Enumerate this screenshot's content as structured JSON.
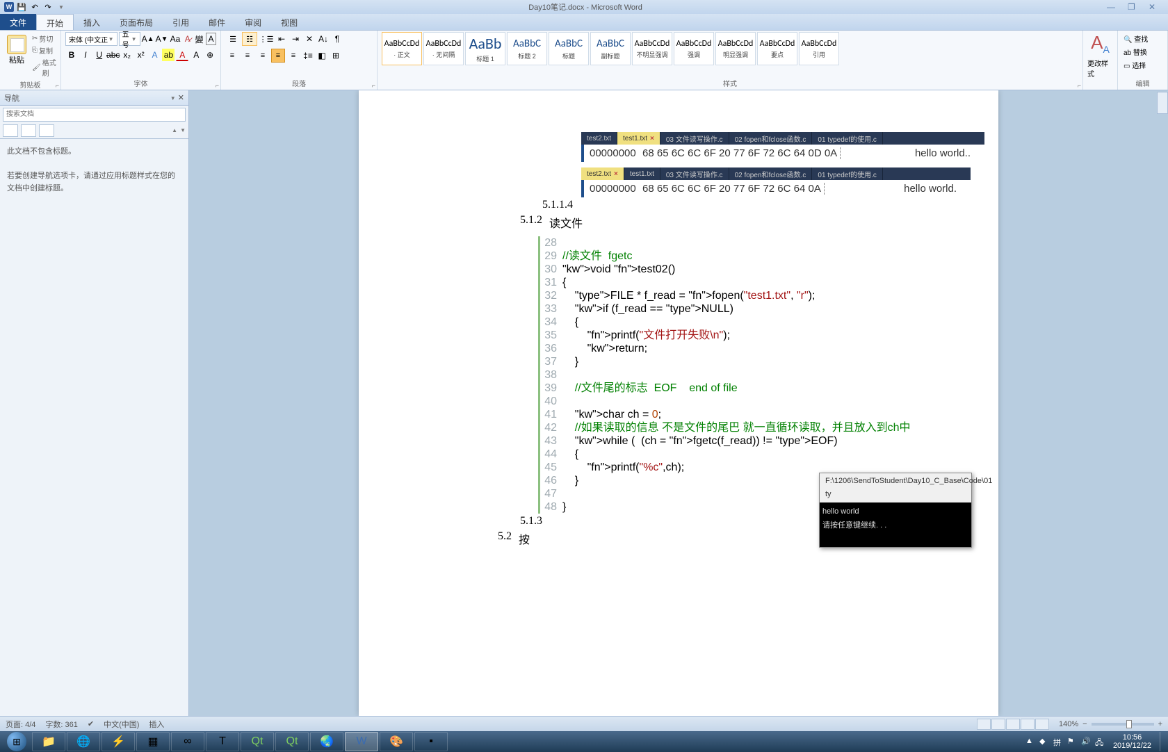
{
  "window": {
    "title": "Day10笔记.docx - Microsoft Word"
  },
  "ribbon": {
    "tabs": {
      "file": "文件",
      "home": "开始",
      "insert": "插入",
      "pagelayout": "页面布局",
      "references": "引用",
      "mailings": "邮件",
      "review": "审阅",
      "view": "视图"
    },
    "clipboard": {
      "paste": "粘贴",
      "cut": "剪切",
      "copy": "复制",
      "format_painter": "格式刷",
      "title": "剪贴板"
    },
    "font": {
      "name": "宋体 (中文正",
      "size": "五号",
      "title": "字体"
    },
    "paragraph": {
      "title": "段落"
    },
    "styles": {
      "title": "样式",
      "items": [
        {
          "preview": "AaBbCcDd",
          "name": "· 正文",
          "cls": ""
        },
        {
          "preview": "AaBbCcDd",
          "name": "· 无间隔",
          "cls": ""
        },
        {
          "preview": "AaBb",
          "name": "标题 1",
          "cls": "big"
        },
        {
          "preview": "AaBbC",
          "name": "标题 2",
          "cls": "med"
        },
        {
          "preview": "AaBbC",
          "name": "标题",
          "cls": "med"
        },
        {
          "preview": "AaBbC",
          "name": "副标题",
          "cls": "med"
        },
        {
          "preview": "AaBbCcDd",
          "name": "不明显强调",
          "cls": ""
        },
        {
          "preview": "AaBbCcDd",
          "name": "强调",
          "cls": ""
        },
        {
          "preview": "AaBbCcDd",
          "name": "明显强调",
          "cls": ""
        },
        {
          "preview": "AaBbCcDd",
          "name": "要点",
          "cls": ""
        },
        {
          "preview": "AaBbCcDd",
          "name": "引用",
          "cls": ""
        }
      ],
      "change": "更改样式"
    },
    "editing": {
      "find": "查找",
      "replace": "替换",
      "select": "选择",
      "title": "编辑"
    }
  },
  "nav": {
    "title": "导航",
    "search_placeholder": "搜索文档",
    "msg1": "此文档不包含标题。",
    "msg2": "若要创建导航选项卡，请通过应用标题样式在您的文档中创建标题。"
  },
  "doc": {
    "hex1": {
      "tabs": [
        "test2.txt",
        "test1.txt",
        "03 文件读写操作.c",
        "02 fopen和fclose函数.c",
        "01 typedef的使用.c"
      ],
      "active": 1,
      "offset": "00000000",
      "bytes": "68 65 6C 6C 6F 20 77 6F  72 6C 64 0D 0A",
      "ascii": "hello world.."
    },
    "hex2": {
      "tabs": [
        "test2.txt",
        "test1.txt",
        "03 文件读写操作.c",
        "02 fopen和fclose函数.c",
        "01 typedef的使用.c"
      ],
      "active": 0,
      "offset": "00000000",
      "bytes": "68 65 6C 6C 6F 20 77 6F  72 6C 64 0A",
      "ascii": "hello world."
    },
    "sec_5114": "5.1.1.4",
    "sec_512": "5.1.2",
    "sec_512_title": "读文件",
    "sec_513": "5.1.3",
    "sec_52": "5.2",
    "sec_52_title": "按",
    "code": [
      {
        "n": "28",
        "t": ""
      },
      {
        "n": "29",
        "t": "//读文件  fgetc",
        "cls": "cmt"
      },
      {
        "n": "30",
        "t": "void test02()"
      },
      {
        "n": "31",
        "t": "{"
      },
      {
        "n": "32",
        "t": "    FILE * f_read = fopen(\"test1.txt\", \"r\");"
      },
      {
        "n": "33",
        "t": "    if (f_read == NULL)"
      },
      {
        "n": "34",
        "t": "    {"
      },
      {
        "n": "35",
        "t": "        printf(\"文件打开失败\\n\");"
      },
      {
        "n": "36",
        "t": "        return;"
      },
      {
        "n": "37",
        "t": "    }"
      },
      {
        "n": "38",
        "t": ""
      },
      {
        "n": "39",
        "t": "    //文件尾的标志  EOF    end of file",
        "cls": "cmt"
      },
      {
        "n": "40",
        "t": ""
      },
      {
        "n": "41",
        "t": "    char ch = 0;"
      },
      {
        "n": "42",
        "t": "    //如果读取的信息 不是文件的尾巴 就一直循环读取，并且放入到ch中",
        "cls": "cmt"
      },
      {
        "n": "43",
        "t": "    while (  (ch = fgetc(f_read)) != EOF)"
      },
      {
        "n": "44",
        "t": "    {"
      },
      {
        "n": "45",
        "t": "        printf(\"%c\",ch);"
      },
      {
        "n": "46",
        "t": "    }"
      },
      {
        "n": "47",
        "t": ""
      },
      {
        "n": "48",
        "t": "}"
      }
    ],
    "console": {
      "title": "F:\\1206\\SendToStudent\\Day10_C_Base\\Code\\01 ty",
      "line1": "hello world",
      "line2": "请按任意键继续. . ."
    }
  },
  "status": {
    "page": "页面: 4/4",
    "words": "字数: 361",
    "lang": "中文(中国)",
    "mode": "插入",
    "zoom": "140%"
  },
  "tray": {
    "time": "10:56",
    "date": "2019/12/22"
  }
}
